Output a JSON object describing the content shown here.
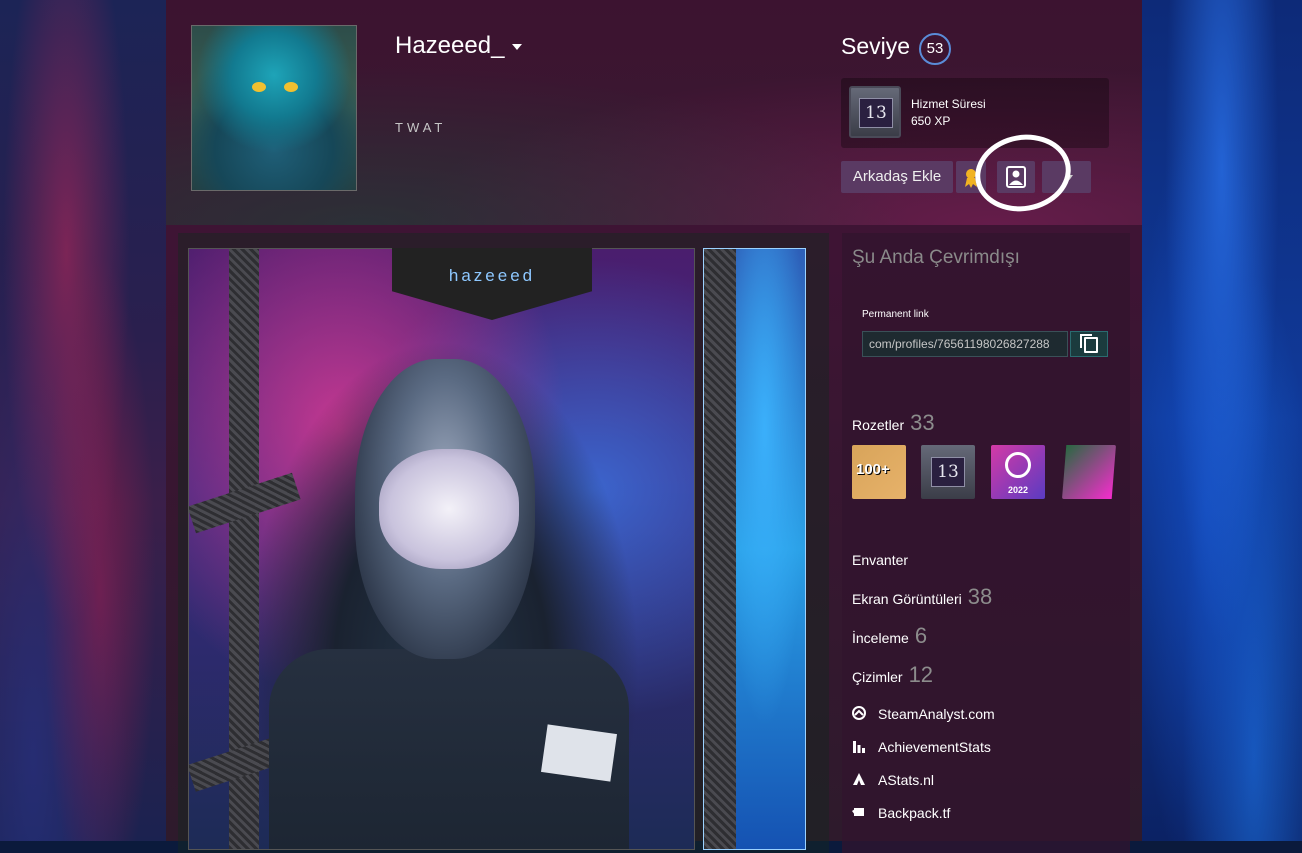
{
  "profile": {
    "persona_name": "Hazeeed_",
    "real_name": "TWAT",
    "level_label": "Seviye",
    "level": "53"
  },
  "years_badge": {
    "icon_number": "13",
    "name": "Hizmet Süresi",
    "xp": "650 XP"
  },
  "actions": {
    "add_friend": "Arkadaş Ekle"
  },
  "status": {
    "text": "Şu Anda Çevrimdışı"
  },
  "permalink": {
    "label": "Permanent link",
    "value": "com/profiles/76561198026827288"
  },
  "showcase": {
    "nameplate": "hazeeed"
  },
  "badges": {
    "label": "Rozetler",
    "count": "33",
    "items": [
      {
        "name": "100+",
        "icon": "100-plus-badge"
      },
      {
        "name": "13",
        "icon": "years-of-service-badge"
      },
      {
        "name": "2022",
        "icon": "steam-replay-2022-badge"
      },
      {
        "name": "",
        "icon": "pink-portrait-badge"
      }
    ]
  },
  "links": {
    "inventory": "Envanter",
    "screenshots_label": "Ekran Görüntüleri",
    "screenshots_count": "38",
    "reviews_label": "İnceleme",
    "reviews_count": "6",
    "artwork_label": "Çizimler",
    "artwork_count": "12"
  },
  "external_links": [
    {
      "label": "SteamAnalyst.com",
      "icon": "steamanalyst-icon"
    },
    {
      "label": "AchievementStats",
      "icon": "bar-chart-icon"
    },
    {
      "label": "AStats.nl",
      "icon": "astats-icon"
    },
    {
      "label": "Backpack.tf",
      "icon": "backpack-icon"
    }
  ],
  "colors": {
    "level_ring": "#5a8cd8",
    "button_bg": "#5a3a63",
    "offline_text": "#8a8a8a",
    "annotation": "#ffffff"
  }
}
